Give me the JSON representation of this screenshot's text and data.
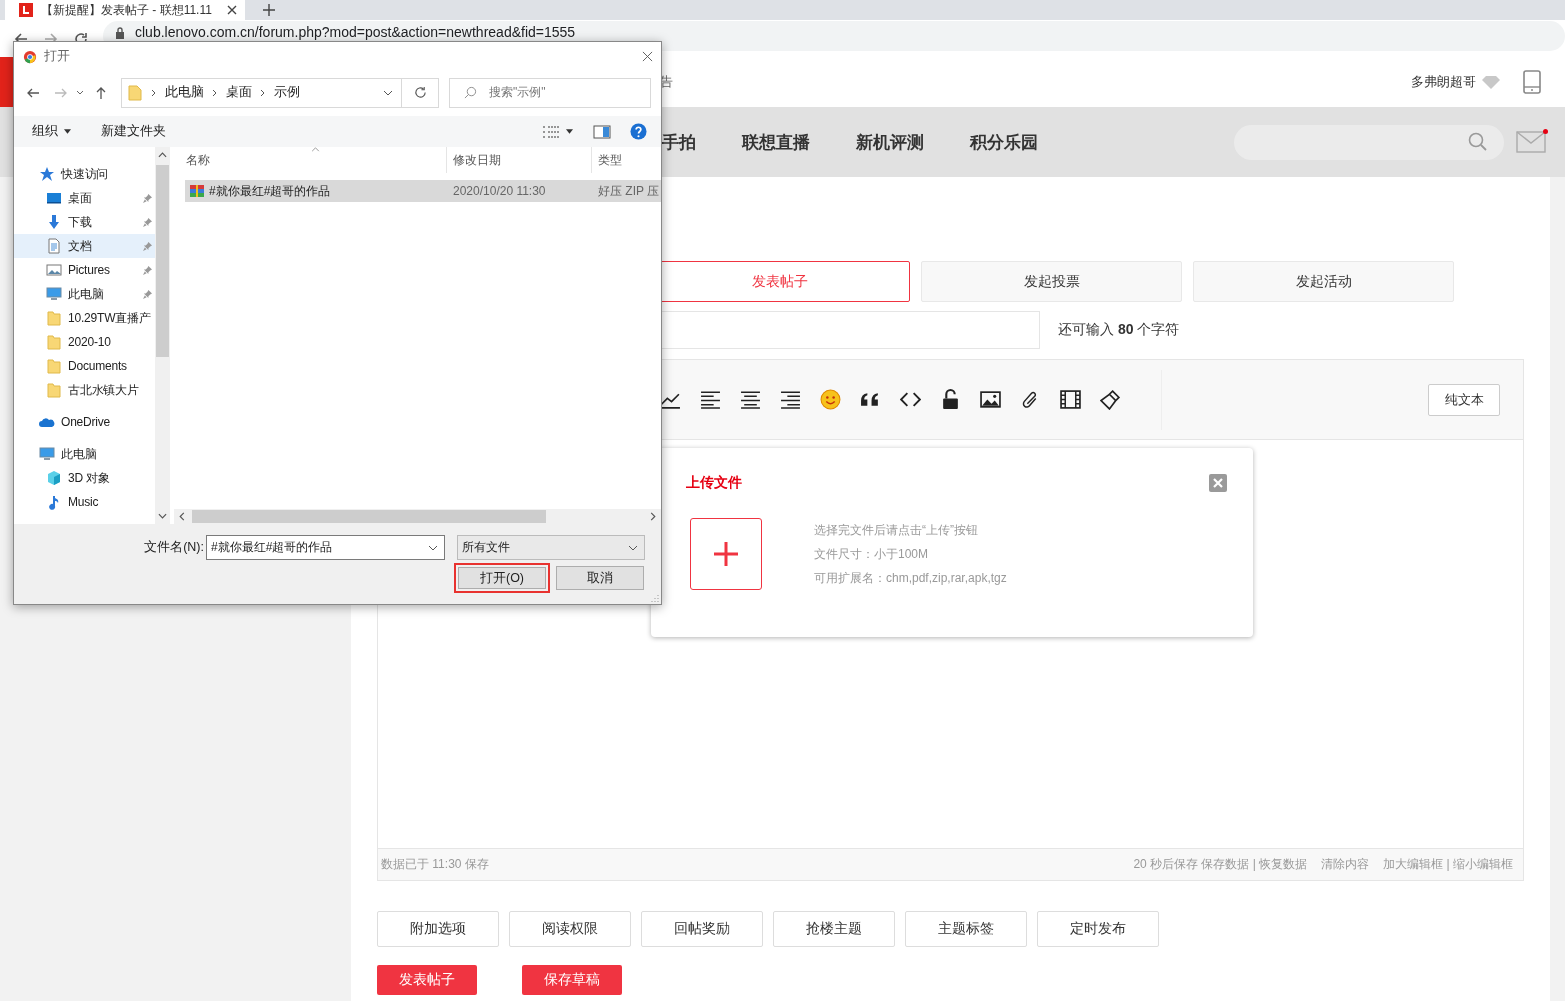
{
  "browser": {
    "tab_title": "【新提醒】发表帖子 - 联想11.11",
    "url": "club.lenovo.com.cn/forum.php?mod=post&action=newthread&fid=1555"
  },
  "header": {
    "partial_text": "告",
    "username": "多弗朗超哥"
  },
  "nav": {
    "items": [
      "手拍",
      "联想直播",
      "新机评测",
      "积分乐园"
    ],
    "mail_unread": true
  },
  "post_types": [
    {
      "label": "发表帖子",
      "selected": true
    },
    {
      "label": "发起投票",
      "selected": false
    },
    {
      "label": "发起活动",
      "selected": false
    }
  ],
  "title_counter": "还可输入 **80** 个字符",
  "editor": {
    "plain_text_button": "纯文本",
    "status_left": "数据已于 11:30 保存",
    "status_right": [
      "20 秒后保存 保存数据 | 恢复数据",
      "清除内容",
      "加大编辑框 | 缩小编辑框"
    ]
  },
  "options": [
    "附加选项",
    "阅读权限",
    "回帖奖励",
    "抢楼主题",
    "主题标签",
    "定时发布"
  ],
  "actions": [
    "发表帖子",
    "保存草稿"
  ],
  "upload_popup": {
    "title": "上传文件",
    "hints": [
      "选择完文件后请点击“上传”按钮",
      "文件尺寸：小于100M",
      "可用扩展名：chm,pdf,zip,rar,apk,tgz"
    ]
  },
  "file_dialog": {
    "title": "打开",
    "breadcrumb": [
      "此电脑",
      "桌面",
      "示例"
    ],
    "search_placeholder": "搜索\"示例\"",
    "organize": "组织",
    "new_folder": "新建文件夹",
    "nav_tree": [
      {
        "label": "快速访问",
        "kind": "star",
        "pinned": false,
        "selected": false,
        "children": [
          {
            "label": "桌面",
            "kind": "desktop",
            "pinned": true,
            "selected": false
          },
          {
            "label": "下载",
            "kind": "download",
            "pinned": true,
            "selected": false
          },
          {
            "label": "文档",
            "kind": "document",
            "pinned": true,
            "selected": true
          },
          {
            "label": "Pictures",
            "kind": "pictures",
            "pinned": true,
            "selected": false
          },
          {
            "label": "此电脑",
            "kind": "computer",
            "pinned": true,
            "selected": false
          },
          {
            "label": "10.29TW直播产",
            "kind": "folder",
            "pinned": false,
            "selected": false
          },
          {
            "label": "2020-10",
            "kind": "folder",
            "pinned": false,
            "selected": false
          },
          {
            "label": "Documents",
            "kind": "folder",
            "pinned": false,
            "selected": false
          },
          {
            "label": "古北水镇大片",
            "kind": "folder",
            "pinned": false,
            "selected": false
          }
        ]
      },
      {
        "label": "OneDrive",
        "kind": "cloud",
        "pinned": false,
        "selected": false
      },
      {
        "label": "此电脑",
        "kind": "computer",
        "pinned": false,
        "selected": false,
        "children": [
          {
            "label": "3D 对象",
            "kind": "cube",
            "pinned": false,
            "selected": false
          },
          {
            "label": "Music",
            "kind": "music",
            "pinned": false,
            "selected": false
          }
        ]
      }
    ],
    "columns": [
      "名称",
      "修改日期",
      "类型"
    ],
    "files": [
      {
        "name": "#就你最红#超哥的作品",
        "date": "2020/10/20 11:30",
        "type": "好压 ZIP 压",
        "selected": true
      }
    ],
    "filename_label": "文件名(N):",
    "filename": "#就你最红#超哥的作品",
    "filetype": "所有文件",
    "buttons": [
      {
        "label": "打开(O)",
        "highlighted": true
      },
      {
        "label": "取消",
        "highlighted": false
      }
    ]
  }
}
